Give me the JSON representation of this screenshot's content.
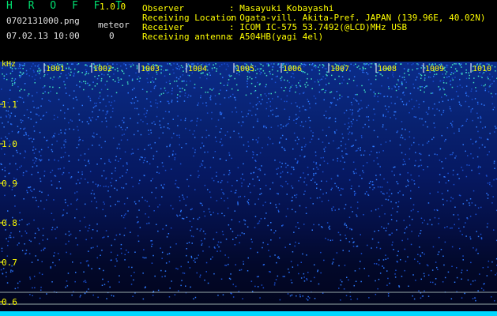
{
  "app": {
    "title": "H R O F F T",
    "version": "1.0.0"
  },
  "file": {
    "name": "0702131000.png",
    "datetime": "07.02.13 10:00"
  },
  "meteor": {
    "label": "meteor",
    "count": "0"
  },
  "info": [
    {
      "label": "Observer",
      "value": ": Masayuki Kobayashi"
    },
    {
      "label": "Receiving Location",
      "value": ": Ogata-vill. Akita-Pref. JAPAN (139.96E, 40.02N)"
    },
    {
      "label": "Receiver",
      "value": ": ICOM IC-575 53.7492(@LCD)MHz USB"
    },
    {
      "label": "Receiving antenna",
      "value": ": A504HB(yagi 4el)"
    }
  ],
  "axis": {
    "unit": "kHz",
    "freq_labels": [
      "1.1",
      "1.0",
      "0.9",
      "0.8",
      "0.7",
      "0.6"
    ],
    "time_labels": [
      "1001",
      "1002",
      "1003",
      "1004",
      "1005",
      "1006",
      "1007",
      "1008",
      "1009",
      "1010"
    ]
  },
  "colors": {
    "label": "#ffff00",
    "title": "#00e070",
    "grid": "#ffffff",
    "noise": "#2f7bff",
    "baseline": "#00e0ff"
  }
}
